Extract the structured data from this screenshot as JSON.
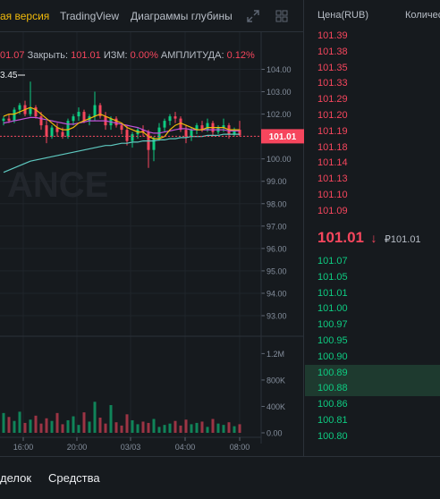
{
  "chart_tabs": {
    "lite": "ая версия",
    "tradingview": "TradingView",
    "depth": "Диаграммы глубины"
  },
  "icons": {
    "expand": "expand-icon",
    "grid": "grid-icon"
  },
  "ohlc": {
    "open_value": "01.07",
    "close_label": "Закрыть:",
    "close_value": "101.01",
    "change_label": "ИЗМ:",
    "change_value": "0.00%",
    "amplitude_label": "АМПЛИТУДА:",
    "amplitude_value": "0.12%"
  },
  "high_marker": "3.45",
  "current_price_tag": "101.01",
  "watermark": "ANCE",
  "colors": {
    "up": "#0ecb81",
    "down": "#f6465d",
    "ma_short": "#f0b90b",
    "ma_mid": "#c051d9",
    "ma_long": "#5ec9c0",
    "accent": "#f0b90b",
    "background": "#161a1e"
  },
  "chart_data": {
    "type": "candlestick",
    "price_axis_ticks": [
      "104.00",
      "103.00",
      "102.00",
      "101.00",
      "100.00",
      "99.00",
      "98.00",
      "97.00",
      "96.00",
      "95.00",
      "94.00",
      "93.00"
    ],
    "price_range": [
      92.6,
      104.3
    ],
    "volume_axis_ticks": [
      "1.2M",
      "800K",
      "400K",
      "0.00"
    ],
    "volume_range": [
      0,
      1300000
    ],
    "time_ticks": [
      "16:00",
      "20:00",
      "03/03",
      "04:00",
      "08:00"
    ],
    "candles": [
      [
        101.7,
        101.9,
        101.5,
        101.8
      ],
      [
        101.8,
        102.0,
        101.6,
        101.7
      ],
      [
        101.7,
        102.3,
        101.6,
        102.2
      ],
      [
        102.2,
        102.5,
        102.0,
        102.4
      ],
      [
        102.4,
        102.6,
        101.9,
        102.0
      ],
      [
        102.0,
        103.45,
        101.9,
        102.3
      ],
      [
        102.3,
        102.4,
        101.8,
        101.9
      ],
      [
        101.9,
        102.1,
        101.3,
        101.5
      ],
      [
        101.5,
        101.7,
        100.7,
        101.0
      ],
      [
        101.0,
        101.5,
        100.9,
        101.4
      ],
      [
        101.4,
        101.6,
        101.0,
        101.2
      ],
      [
        101.2,
        101.4,
        100.9,
        101.0
      ],
      [
        101.0,
        101.8,
        100.9,
        101.7
      ],
      [
        101.7,
        102.0,
        101.5,
        101.9
      ],
      [
        101.9,
        102.3,
        101.7,
        102.1
      ],
      [
        102.1,
        102.2,
        101.6,
        101.7
      ],
      [
        101.7,
        102.0,
        101.5,
        101.9
      ],
      [
        101.9,
        103.0,
        101.7,
        102.4
      ],
      [
        102.4,
        102.5,
        101.8,
        101.9
      ],
      [
        101.9,
        102.1,
        101.3,
        101.5
      ],
      [
        101.5,
        101.9,
        101.3,
        101.8
      ],
      [
        101.8,
        101.9,
        101.4,
        101.5
      ],
      [
        101.5,
        101.6,
        101.1,
        101.3
      ],
      [
        101.3,
        101.5,
        100.6,
        100.8
      ],
      [
        100.8,
        101.2,
        100.5,
        101.1
      ],
      [
        101.1,
        101.4,
        100.9,
        101.3
      ],
      [
        101.3,
        101.5,
        101.0,
        101.2
      ],
      [
        101.2,
        101.3,
        99.6,
        100.4
      ],
      [
        100.4,
        101.0,
        99.9,
        100.9
      ],
      [
        100.9,
        101.6,
        100.8,
        101.4
      ],
      [
        101.4,
        101.8,
        101.2,
        101.7
      ],
      [
        101.7,
        102.0,
        101.5,
        101.9
      ],
      [
        101.9,
        102.1,
        101.6,
        101.8
      ],
      [
        101.8,
        101.9,
        101.2,
        101.3
      ],
      [
        101.3,
        101.5,
        100.7,
        101.0
      ],
      [
        101.0,
        101.4,
        100.8,
        101.3
      ],
      [
        101.3,
        101.6,
        101.1,
        101.5
      ],
      [
        101.5,
        101.7,
        101.2,
        101.3
      ],
      [
        101.3,
        101.8,
        101.2,
        101.6
      ],
      [
        101.6,
        101.7,
        101.0,
        101.2
      ],
      [
        101.2,
        101.5,
        101.1,
        101.4
      ],
      [
        101.4,
        101.8,
        101.2,
        101.5
      ],
      [
        101.5,
        101.6,
        100.9,
        101.1
      ],
      [
        101.1,
        101.4,
        101.0,
        101.3
      ],
      [
        101.3,
        101.7,
        101.0,
        101.05
      ]
    ],
    "volumes": [
      300000,
      240000,
      180000,
      320000,
      150000,
      200000,
      260000,
      140000,
      220000,
      180000,
      300000,
      130000,
      190000,
      250000,
      120000,
      310000,
      170000,
      470000,
      230000,
      140000,
      420000,
      160000,
      110000,
      280000,
      190000,
      130000,
      170000,
      150000,
      210000,
      90000,
      120000,
      140000,
      180000,
      110000,
      200000,
      130000,
      150000,
      170000,
      90000,
      210000,
      140000,
      120000,
      160000,
      100000,
      130000
    ],
    "ma_short": [
      101.9,
      102.0,
      102.0,
      102.1,
      102.2,
      102.3,
      102.2,
      102.0,
      101.8,
      101.6,
      101.4,
      101.3,
      101.3,
      101.4,
      101.6,
      101.7,
      101.8,
      101.9,
      102.0,
      101.9,
      101.8,
      101.7,
      101.6,
      101.4,
      101.3,
      101.2,
      101.2,
      101.0,
      100.9,
      100.9,
      101.0,
      101.3,
      101.5,
      101.6,
      101.5,
      101.4,
      101.3,
      101.3,
      101.4,
      101.4,
      101.4,
      101.4,
      101.3,
      101.3,
      101.3
    ],
    "ma_mid": [
      101.6,
      101.65,
      101.7,
      101.75,
      101.8,
      101.85,
      101.85,
      101.8,
      101.75,
      101.7,
      101.65,
      101.6,
      101.55,
      101.55,
      101.6,
      101.65,
      101.7,
      101.7,
      101.7,
      101.7,
      101.65,
      101.6,
      101.55,
      101.5,
      101.45,
      101.4,
      101.3,
      101.2,
      101.15,
      101.15,
      101.2,
      101.25,
      101.3,
      101.35,
      101.35,
      101.3,
      101.3,
      101.3,
      101.3,
      101.3,
      101.3,
      101.3,
      101.25,
      101.25,
      101.25
    ],
    "ma_long": [
      99.4,
      99.5,
      99.6,
      99.7,
      99.8,
      99.9,
      99.95,
      100.0,
      100.05,
      100.1,
      100.15,
      100.2,
      100.25,
      100.3,
      100.35,
      100.4,
      100.45,
      100.5,
      100.55,
      100.6,
      100.6,
      100.65,
      100.7,
      100.7,
      100.75,
      100.75,
      100.8,
      100.8,
      100.8,
      100.85,
      100.85,
      100.9,
      100.9,
      100.95,
      100.95,
      101.0,
      101.0,
      101.0,
      101.05,
      101.05,
      101.05,
      101.1,
      101.1,
      101.1,
      101.1
    ]
  },
  "orderbook": {
    "header_price": "Цена(RUB)",
    "header_qty": "Количес",
    "asks": [
      "101.39",
      "101.38",
      "101.35",
      "101.33",
      "101.29",
      "101.20",
      "101.19",
      "101.18",
      "101.14",
      "101.13",
      "101.10",
      "101.09"
    ],
    "mid_price": "101.01",
    "mid_arrow": "↓",
    "mid_fiat": "₽101.01",
    "bids": [
      "101.07",
      "101.05",
      "101.01",
      "101.00",
      "100.97",
      "100.95",
      "100.90",
      "100.89",
      "100.88",
      "100.86",
      "100.81",
      "100.80"
    ]
  },
  "bottom_tabs": {
    "trades": "делок",
    "funds": "Средства"
  }
}
